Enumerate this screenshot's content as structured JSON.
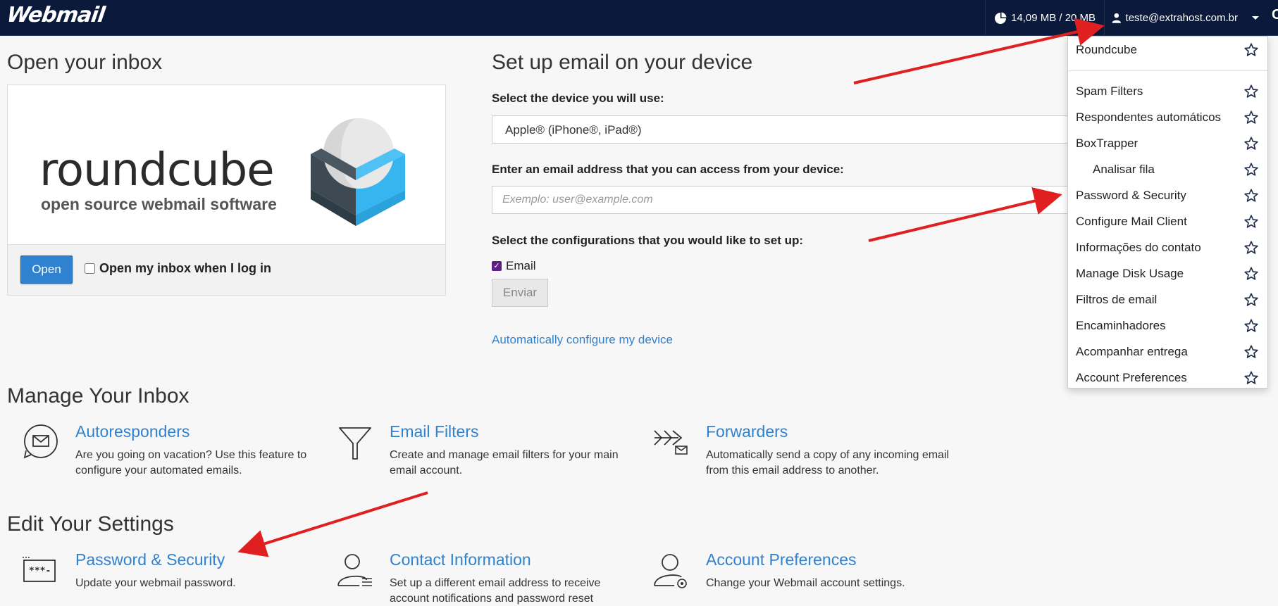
{
  "topbar": {
    "brand": "Webmail",
    "quota": "14,09 MB / 20 MB",
    "user": "teste@extrahost.com.br",
    "edge": "C"
  },
  "open_inbox": {
    "title": "Open your inbox",
    "logo_word": "roundcube",
    "logo_tagline": "open source webmail software",
    "open_button": "Open",
    "open_on_login_label": "Open my inbox when I log in",
    "open_on_login_checked": false
  },
  "setup": {
    "title": "Set up email on your device",
    "device_label": "Select the device you will use:",
    "device_value": "Apple® (iPhone®, iPad®)",
    "email_label": "Enter an email address that you can access from your device:",
    "email_placeholder": "Exemplo: user@example.com",
    "config_label": "Select the configurations that you would like to set up:",
    "email_checkbox_label": "Email",
    "email_checked": true,
    "submit_button": "Enviar",
    "auto_link": "Automatically configure my device"
  },
  "manage": {
    "title": "Manage Your Inbox",
    "items": [
      {
        "title": "Autoresponders",
        "desc": "Are you going on vacation? Use this feature to configure your automated emails.",
        "icon": "autoresponder-icon"
      },
      {
        "title": "Email Filters",
        "desc": "Create and manage email filters for your main email account.",
        "icon": "filter-icon"
      },
      {
        "title": "Forwarders",
        "desc": "Automatically send a copy of any incoming email from this email address to another.",
        "icon": "forwarder-icon"
      }
    ]
  },
  "edit": {
    "title": "Edit Your Settings",
    "items": [
      {
        "title": "Password & Security",
        "desc": "Update your webmail password.",
        "icon": "password-icon"
      },
      {
        "title": "Contact Information",
        "desc": "Set up a different email address to receive account notifications and password reset",
        "icon": "contact-icon"
      },
      {
        "title": "Account Preferences",
        "desc": "Change your Webmail account settings.",
        "icon": "account-prefs-icon"
      }
    ]
  },
  "dropdown": {
    "items": [
      {
        "label": "Roundcube"
      },
      {
        "label": "Spam Filters"
      },
      {
        "label": "Respondentes automáticos"
      },
      {
        "label": "BoxTrapper"
      },
      {
        "label": "Analisar fila"
      },
      {
        "label": "Password & Security"
      },
      {
        "label": "Configure Mail Client"
      },
      {
        "label": "Informações do contato"
      },
      {
        "label": "Manage Disk Usage"
      },
      {
        "label": "Filtros de email"
      },
      {
        "label": "Encaminhadores"
      },
      {
        "label": "Acompanhar entrega"
      },
      {
        "label": "Account Preferences"
      }
    ]
  },
  "colors": {
    "topbar": "#0b1a3a",
    "link": "#2f82cf",
    "annotation_arrow": "#e02020"
  }
}
